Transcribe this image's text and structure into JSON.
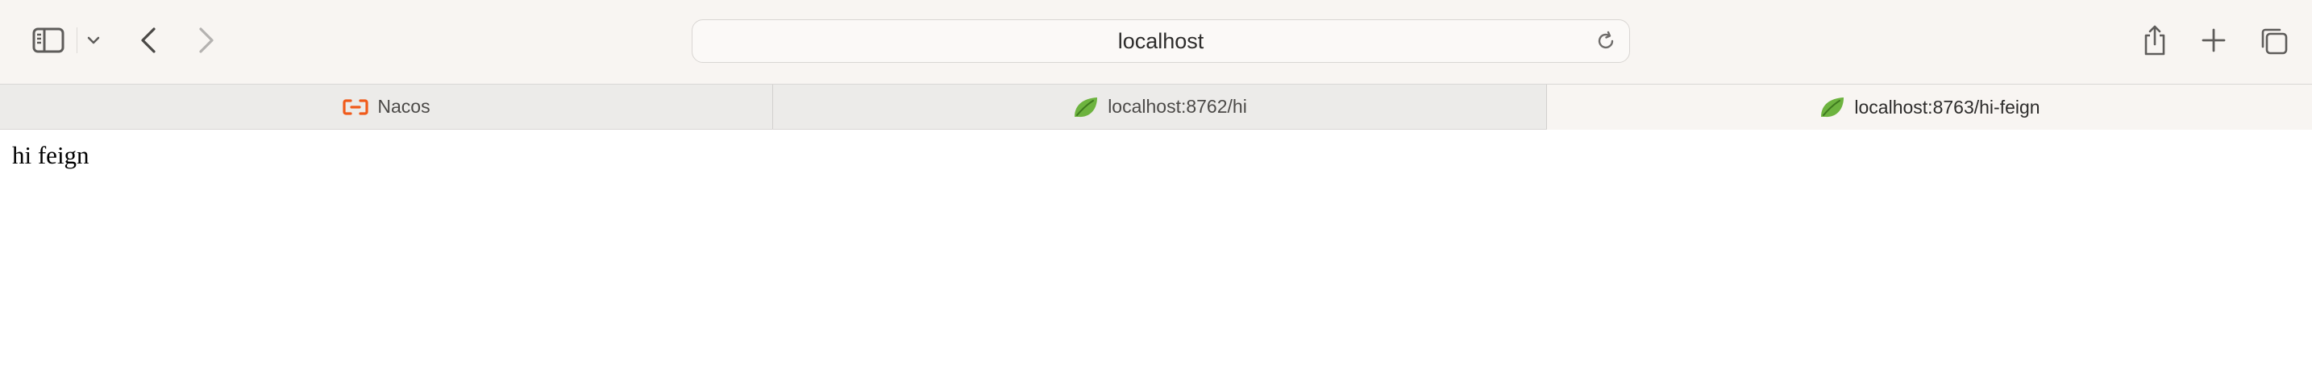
{
  "toolbar": {
    "address": "localhost",
    "icons": {
      "sidebar": "sidebar-icon",
      "sidebar_menu": "chevron-down-icon",
      "back": "chevron-left-icon",
      "forward": "chevron-right-icon",
      "reload": "reload-icon",
      "share": "share-icon",
      "new_tab": "plus-icon",
      "tab_overview": "tab-overview-icon"
    }
  },
  "tabs": [
    {
      "label": "Nacos",
      "favicon": "nacos-logo-icon",
      "active": false
    },
    {
      "label": "localhost:8762/hi",
      "favicon": "spring-leaf-icon",
      "active": false
    },
    {
      "label": "localhost:8763/hi-feign",
      "favicon": "spring-leaf-icon",
      "active": true
    }
  ],
  "page": {
    "body_text": "hi feign"
  },
  "colors": {
    "toolbar_bg": "#f8f5f2",
    "tabbar_bg": "#ecebe9",
    "nacos_orange": "#f05a1a",
    "spring_green": "#6db33f"
  }
}
